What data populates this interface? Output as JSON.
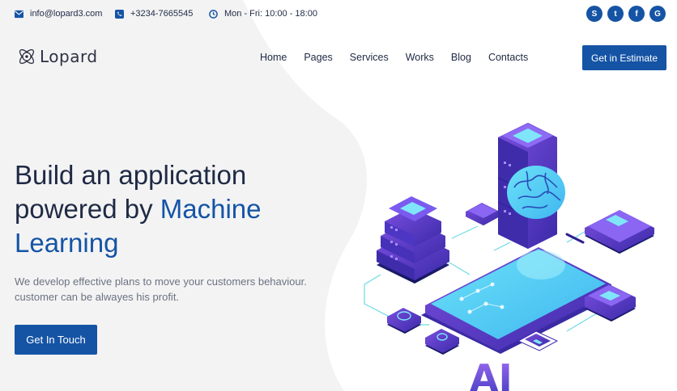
{
  "topbar": {
    "email": "info@lopard3.com",
    "phone": "+3234-7665545",
    "hours": "Mon - Fri: 10:00 - 18:00",
    "social": [
      {
        "name": "skype-icon",
        "glyph": "S"
      },
      {
        "name": "twitter-icon",
        "glyph": "t"
      },
      {
        "name": "facebook-icon",
        "glyph": "f"
      },
      {
        "name": "google-icon",
        "glyph": "G"
      }
    ]
  },
  "header": {
    "logo_text": "Lopard",
    "nav": [
      "Home",
      "Pages",
      "Services",
      "Works",
      "Blog",
      "Contacts"
    ],
    "estimate_label": "Get in Estimate"
  },
  "hero": {
    "title_line1": "Build an application",
    "title_line2_prefix": "powered by ",
    "title_line2_accent": "Machine",
    "title_line3": "Learning",
    "desc_line1": "We develop effective plans to move your customers behaviour.",
    "desc_line2": "customer can be alwayes his profit.",
    "cta_label": "Get In Touch"
  },
  "illustration": {
    "badge_text": "AI"
  },
  "colors": {
    "accent": "#1554a5",
    "text": "#1f2a44",
    "muted": "#6b7280",
    "background_left": "#f3f3f4",
    "phone_screen": "#5ad8f5",
    "server_purple": "#5b35c9"
  }
}
